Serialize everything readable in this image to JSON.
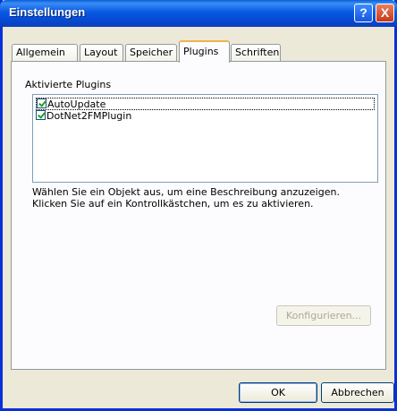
{
  "window": {
    "title": "Einstellungen",
    "help_glyph": "?",
    "close_glyph": "X"
  },
  "tabs": [
    {
      "label": "Allgemein"
    },
    {
      "label": "Layout"
    },
    {
      "label": "Speicher"
    },
    {
      "label": "Plugins",
      "selected": true
    },
    {
      "label": "Schriften"
    }
  ],
  "plugins": {
    "group_label": "Aktivierte Plugins",
    "items": [
      {
        "label": "AutoUpdate",
        "checked": true
      },
      {
        "label": "DotNet2FMPlugin",
        "checked": true
      }
    ],
    "description_line1": "Wählen Sie ein Objekt aus, um eine Beschreibung anzuzeigen.",
    "description_line2": "Klicken Sie auf ein Kontrollkästchen, um es zu aktivieren.",
    "configure_label": "Konfigurieren..."
  },
  "buttons": {
    "ok_label": "OK",
    "cancel_label": "Abbrechen"
  },
  "colors": {
    "titlebar": "#0859e3",
    "window_bg": "#ece9d8",
    "active_tab_accent": "#f2b24a"
  }
}
